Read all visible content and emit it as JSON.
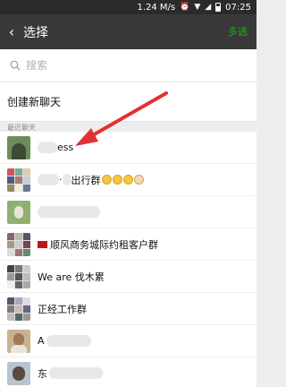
{
  "status_bar": {
    "speed": "1.24 M/s",
    "time": "07:25"
  },
  "title_bar": {
    "back_glyph": "‹",
    "title": "选择",
    "done_label": "多选"
  },
  "search": {
    "placeholder": "搜索"
  },
  "create_chat_label": "创建新聊天",
  "section_label": "最近聊天",
  "chats": [
    {
      "name_suffix": "ess"
    },
    {
      "name_prefix": "·",
      "name_mid": "出行群"
    },
    {
      "name": ""
    },
    {
      "name": "顺风商务城际约租客户群"
    },
    {
      "name": "We are 伐木累"
    },
    {
      "name": "正经工作群"
    },
    {
      "name_prefix": "A"
    },
    {
      "name_prefix": "东"
    }
  ],
  "colors": {
    "accent": "#1aad19",
    "header": "#393939",
    "arrow": "#e03232"
  }
}
